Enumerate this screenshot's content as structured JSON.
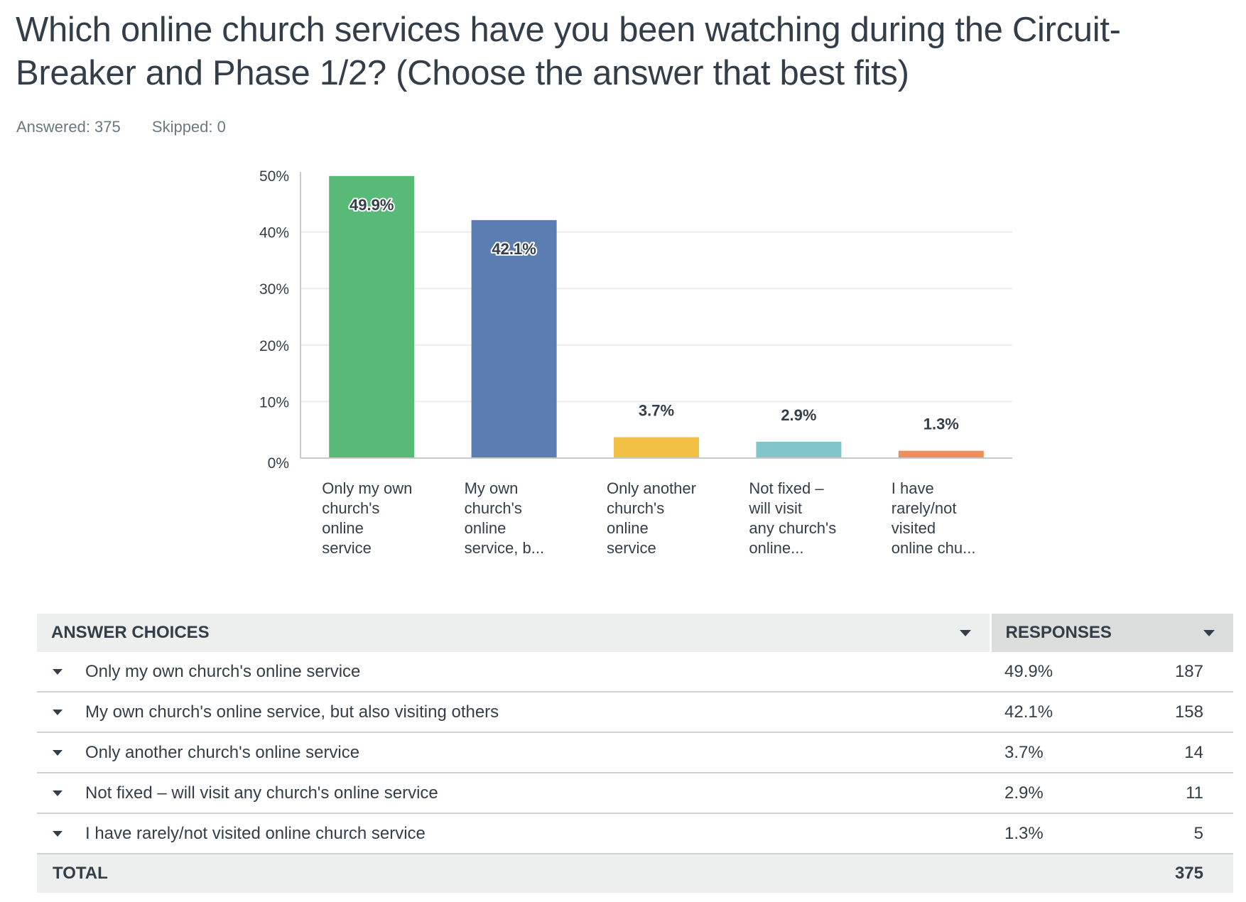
{
  "question": {
    "title": "Which online church services have you been watching during the Circuit-Breaker and Phase 1/2? (Choose the answer that best fits)",
    "answered": "Answered: 375",
    "skipped": "Skipped: 0"
  },
  "chart_data": {
    "type": "bar",
    "title": "",
    "xlabel": "",
    "ylabel": "",
    "ylim": [
      0,
      50
    ],
    "yticks": [
      "0%",
      "10%",
      "20%",
      "30%",
      "40%",
      "50%"
    ],
    "ytick_values": [
      0,
      10,
      20,
      30,
      40,
      50
    ],
    "grid": true,
    "categories": [
      [
        "Only my own",
        "church's",
        "online",
        "service"
      ],
      [
        "My own",
        "church's",
        "online",
        "service, b..."
      ],
      [
        "Only another",
        "church's",
        "online",
        "service"
      ],
      [
        "Not fixed –",
        "will visit",
        "any church's",
        "online..."
      ],
      [
        "I have",
        "rarely/not",
        "visited",
        "online chu..."
      ]
    ],
    "values": [
      49.9,
      42.1,
      3.7,
      2.9,
      1.3
    ],
    "value_labels": [
      "49.9%",
      "42.1%",
      "3.7%",
      "2.9%",
      "1.3%"
    ],
    "colors": [
      "#57bb77",
      "#5b7db1",
      "#f0bf44",
      "#83c6ca",
      "#ef8d5b"
    ]
  },
  "table": {
    "header_answers": "ANSWER CHOICES",
    "header_responses": "RESPONSES",
    "rows": [
      {
        "answer": "Only my own church's online service",
        "percent": "49.9%",
        "count": "187"
      },
      {
        "answer": "My own church's online service, but also visiting others",
        "percent": "42.1%",
        "count": "158"
      },
      {
        "answer": "Only another church's online service",
        "percent": "3.7%",
        "count": "14"
      },
      {
        "answer": "Not fixed – will visit any church's online service",
        "percent": "2.9%",
        "count": "11"
      },
      {
        "answer": "I have rarely/not visited online church service",
        "percent": "1.3%",
        "count": "5"
      }
    ],
    "total_label": "TOTAL",
    "total_count": "375"
  }
}
